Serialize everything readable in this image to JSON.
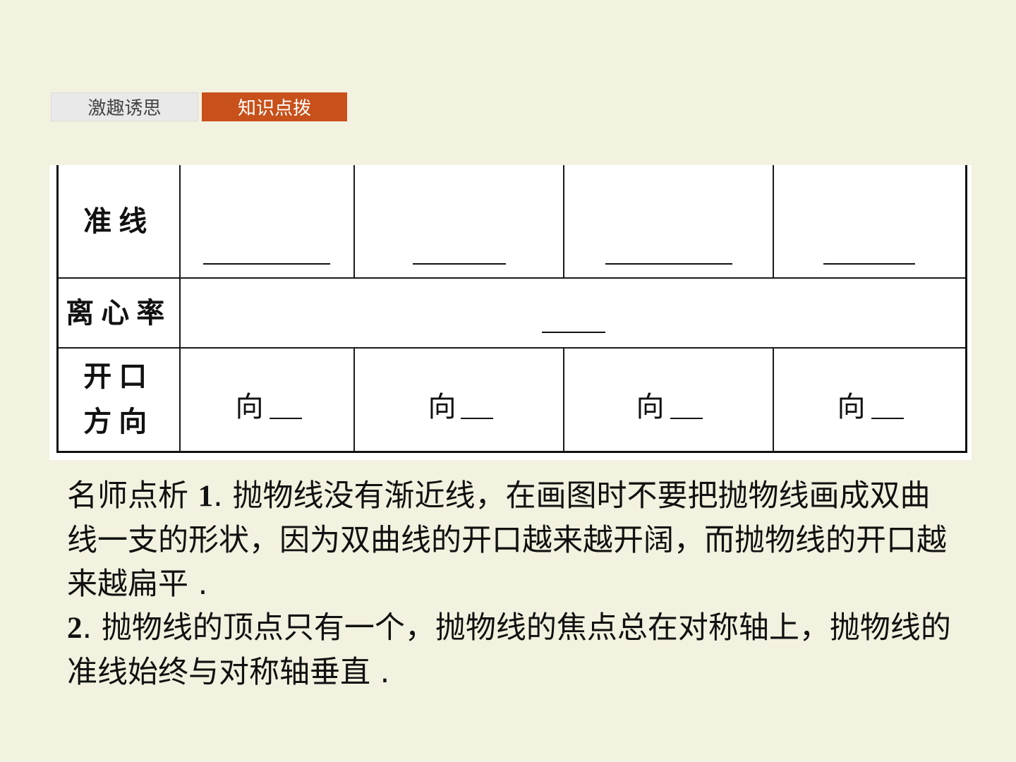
{
  "tabs": [
    {
      "label": "激趣诱思",
      "active": false
    },
    {
      "label": "知识点拨",
      "active": true
    }
  ],
  "colors": {
    "accent": "#c8501a",
    "background": "#f3f1df"
  },
  "table": {
    "row_directrix": "准线",
    "row_eccentricity": "离心率",
    "row_opening_line1": "开口",
    "row_opening_line2": "方向",
    "direction_prefix": "向"
  },
  "notes": {
    "para1_label": "名师点析 ",
    "para1_num": "1",
    "para1_text": ". 抛物线没有渐近线，在画图时不要把抛物线画成双曲线一支的形状，因为双曲线的开口越来越开阔，而抛物线的开口越来越扁平 .",
    "para2_num": "2",
    "para2_text": ". 抛物线的顶点只有一个，抛物线的焦点总在对称轴上，抛物线的准线始终与对称轴垂直 ."
  }
}
